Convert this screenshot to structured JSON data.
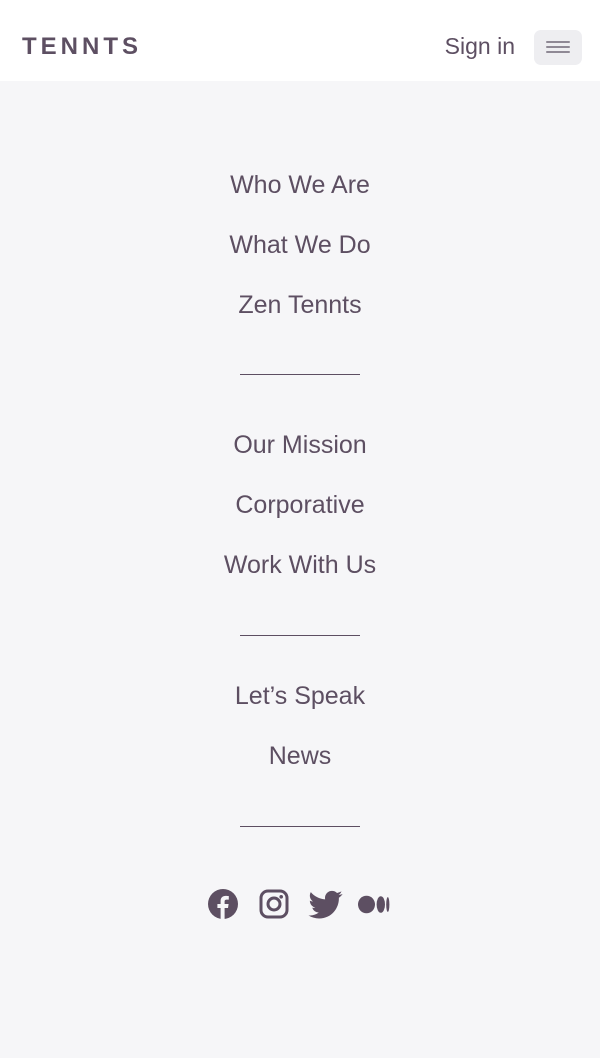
{
  "header": {
    "logo_text": "TENNTS",
    "signin_label": "Sign in",
    "menu_icon": "hamburger-menu-icon"
  },
  "nav": {
    "groups": [
      {
        "items": [
          {
            "label": "Who We Are"
          },
          {
            "label": "What We Do"
          },
          {
            "label": "Zen Tennts"
          }
        ]
      },
      {
        "items": [
          {
            "label": "Our Mission"
          },
          {
            "label": "Corporative"
          },
          {
            "label": "Work With Us"
          }
        ]
      },
      {
        "items": [
          {
            "label": "Let’s Speak"
          },
          {
            "label": "News"
          }
        ]
      }
    ]
  },
  "social": [
    {
      "icon": "facebook-icon"
    },
    {
      "icon": "instagram-icon"
    },
    {
      "icon": "twitter-icon"
    },
    {
      "icon": "medium-icon"
    }
  ],
  "colors": {
    "brand": "#5d4f62",
    "background": "#f6f6f8",
    "header_bg": "#ffffff",
    "menu_button_bg": "#eeeef1"
  }
}
